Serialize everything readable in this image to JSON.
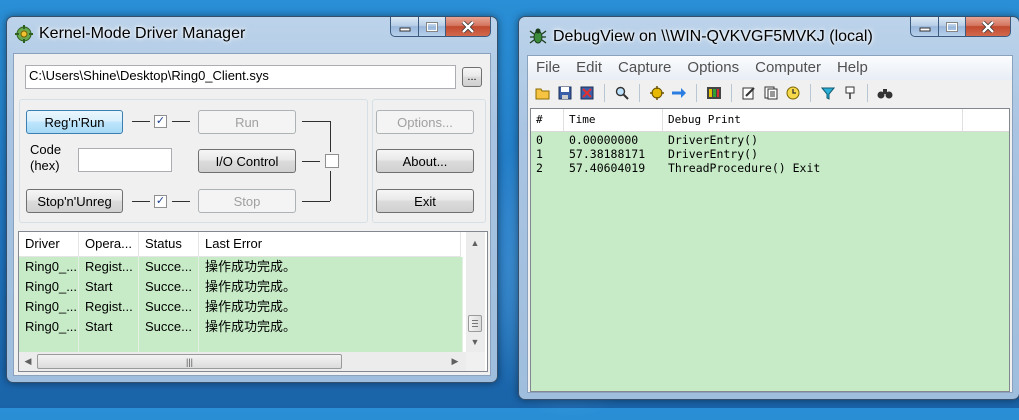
{
  "kmdm": {
    "title": "Kernel-Mode Driver Manager",
    "path_value": "C:\\Users\\Shine\\Desktop\\Ring0_Client.sys",
    "browse_label": "...",
    "regrun_label": "Reg'n'Run",
    "run_label": "Run",
    "code_label_1": "Code",
    "code_label_2": "(hex)",
    "code_value": "",
    "io_label": "I/O Control",
    "stopunreg_label": "Stop'n'Unreg",
    "stop_label": "Stop",
    "options_label": "Options...",
    "about_label": "About...",
    "exit_label": "Exit",
    "check_mark": "✓",
    "columns": [
      "Driver",
      "Opera...",
      "Status",
      "Last Error"
    ],
    "rows": [
      [
        "Ring0_...",
        "Regist...",
        "Succe...",
        "操作成功完成。"
      ],
      [
        "Ring0_...",
        "Start",
        "Succe...",
        "操作成功完成。"
      ],
      [
        "Ring0_...",
        "Regist...",
        "Succe...",
        "操作成功完成。"
      ],
      [
        "Ring0_...",
        "Start",
        "Succe...",
        "操作成功完成。"
      ]
    ]
  },
  "debugview": {
    "title": "DebugView on \\\\WIN-QVKVGF5MVKJ (local)",
    "menu": [
      "File",
      "Edit",
      "Capture",
      "Options",
      "Computer",
      "Help"
    ],
    "columns": [
      "#",
      "Time",
      "Debug Print"
    ],
    "rows": [
      [
        "0",
        "0.00000000",
        "DriverEntry()"
      ],
      [
        "1",
        "57.38188171",
        "DriverEntry()"
      ],
      [
        "2",
        "57.40604019",
        "ThreadProcedure() Exit"
      ]
    ],
    "toolbar_icons": [
      "open-icon",
      "save-icon",
      "clear-icon",
      "find-icon",
      "capture-icon",
      "autoscroll-icon",
      "history-icon",
      "highlight-icon",
      "copy-icon",
      "clock-icon",
      "filter-icon",
      "pin-icon",
      "binoculars-icon"
    ]
  }
}
